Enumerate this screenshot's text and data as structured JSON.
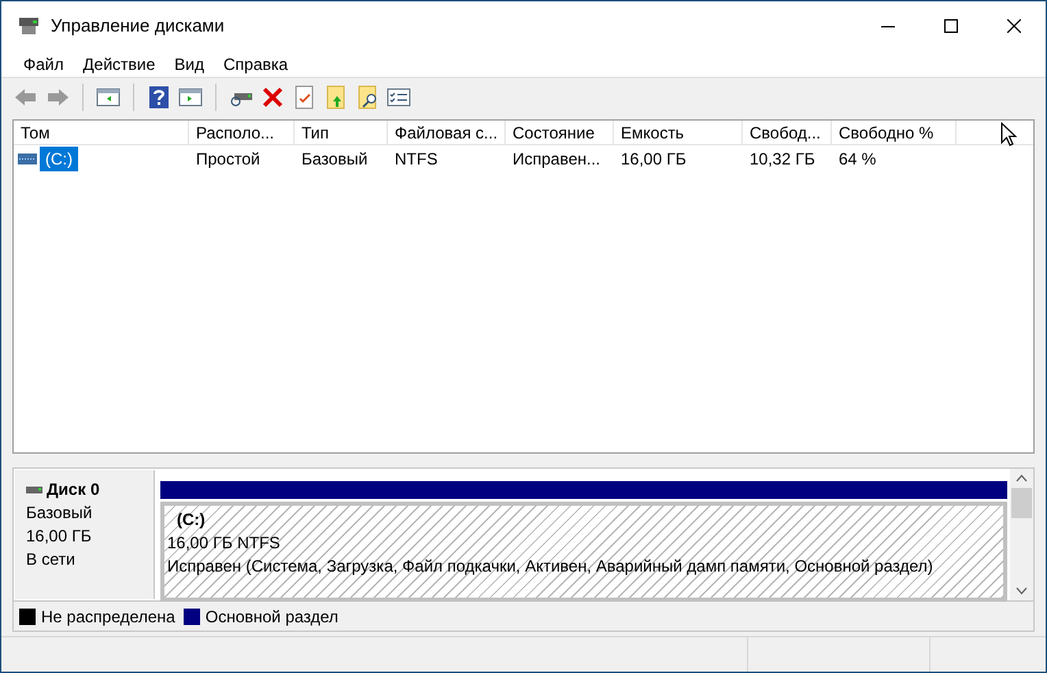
{
  "window": {
    "title": "Управление дисками"
  },
  "menu": [
    "Файл",
    "Действие",
    "Вид",
    "Справка"
  ],
  "table": {
    "columns": [
      "Том",
      "Располо...",
      "Тип",
      "Файловая с...",
      "Состояние",
      "Емкость",
      "Свобод...",
      "Свободно %"
    ],
    "rows": [
      {
        "selected": true,
        "cells": [
          "(C:)",
          "Простой",
          "Базовый",
          "NTFS",
          "Исправен...",
          "16,00 ГБ",
          "10,32 ГБ",
          "64 %"
        ]
      }
    ]
  },
  "disks": [
    {
      "name": "Диск 0",
      "type": "Базовый",
      "size": "16,00 ГБ",
      "status": "В сети",
      "partitions": [
        {
          "label": "(C:)",
          "size": "16,00 ГБ NTFS",
          "status": "Исправен (Система, Загрузка, Файл подкачки, Активен, Аварийный дамп памяти, Основной раздел)",
          "color": "#000080"
        }
      ]
    }
  ],
  "legend": [
    {
      "label": "Не распределена",
      "color": "#000000"
    },
    {
      "label": "Основной раздел",
      "color": "#000080"
    }
  ]
}
